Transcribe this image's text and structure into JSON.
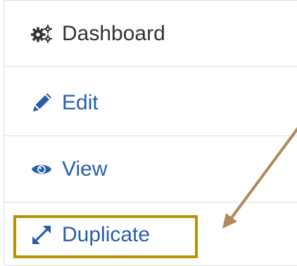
{
  "menu": {
    "items": [
      {
        "label": "Dashboard",
        "icon": "gears-icon"
      },
      {
        "label": "Edit",
        "icon": "pencil-icon"
      },
      {
        "label": "View",
        "icon": "eye-icon"
      },
      {
        "label": "Duplicate",
        "icon": "expand-arrows-icon"
      }
    ]
  },
  "annotation": {
    "highlight_color": "#b89205",
    "arrow_color": "#b08a5a"
  },
  "colors": {
    "link_blue": "#2a5fa5",
    "text_dark": "#333333"
  }
}
